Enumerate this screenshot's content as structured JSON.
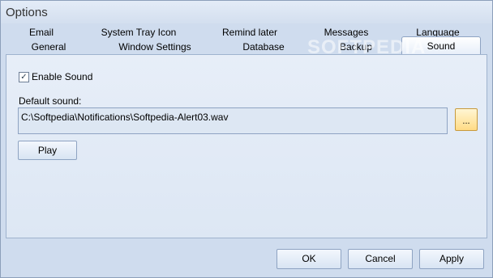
{
  "window": {
    "title": "Options"
  },
  "tabs": {
    "row1": [
      "Email",
      "System Tray Icon",
      "Remind later",
      "Messages",
      "Language"
    ],
    "row2": [
      "General",
      "Window Settings",
      "Database",
      "Backup",
      "Sound"
    ],
    "active": "Sound"
  },
  "sound": {
    "enable_label": "Enable Sound",
    "enable_checked": true,
    "check_glyph": "✓",
    "default_label": "Default sound:",
    "path": "C:\\Softpedia\\Notifications\\Softpedia-Alert03.wav",
    "browse_label": "...",
    "play_label": "Play"
  },
  "buttons": {
    "ok": "OK",
    "cancel": "Cancel",
    "apply": "Apply"
  },
  "watermark": "SOFTPEDIA"
}
